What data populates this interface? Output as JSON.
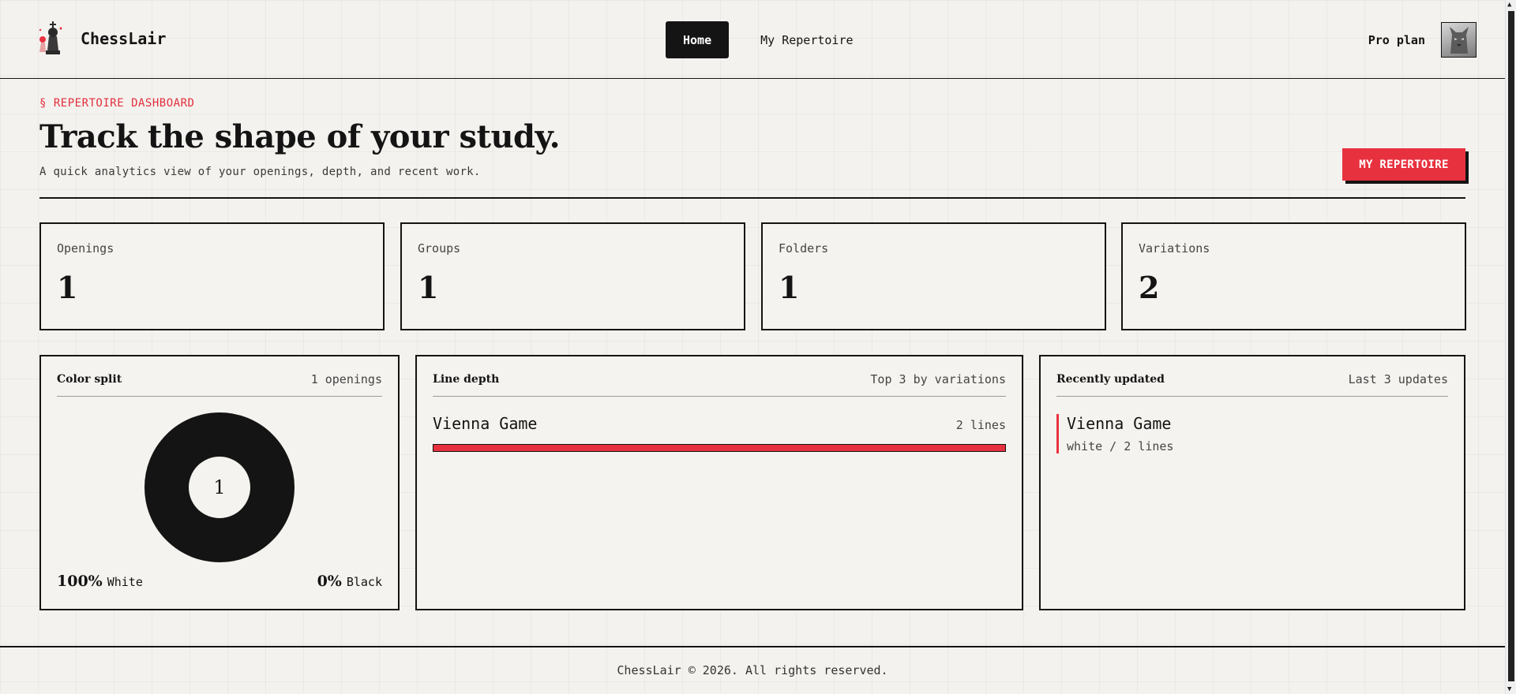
{
  "brand": {
    "name": "ChessLair",
    "logo_icon": "chess-king-icon"
  },
  "nav": {
    "items": [
      {
        "label": "Home",
        "active": true
      },
      {
        "label": "My Repertoire",
        "active": false
      }
    ]
  },
  "account": {
    "plan": "Pro plan",
    "avatar_icon": "cat-avatar-icon"
  },
  "hero": {
    "eyebrow": "§ REPERTOIRE DASHBOARD",
    "title": "Track the shape of your study.",
    "subtitle": "A quick analytics view of your openings, depth, and recent work.",
    "cta": "MY REPERTOIRE"
  },
  "stats": [
    {
      "label": "Openings",
      "value": "1"
    },
    {
      "label": "Groups",
      "value": "1"
    },
    {
      "label": "Folders",
      "value": "1"
    },
    {
      "label": "Variations",
      "value": "2"
    }
  ],
  "color_split": {
    "title": "Color split",
    "meta": "1 openings",
    "center": "1",
    "white_pct": "100%",
    "white_label": "White",
    "black_pct": "0%",
    "black_label": "Black",
    "white_fraction": 1.0
  },
  "line_depth": {
    "title": "Line depth",
    "meta": "Top 3 by variations",
    "lines": [
      {
        "name": "Vienna Game",
        "count": "2 lines",
        "fraction": 1.0
      }
    ]
  },
  "recent": {
    "title": "Recently updated",
    "meta": "Last 3 updates",
    "items": [
      {
        "name": "Vienna Game",
        "meta": "white / 2 lines"
      }
    ]
  },
  "footer": {
    "text": "ChessLair © 2026. All rights reserved."
  },
  "colors": {
    "accent": "#e8313f",
    "ink": "#141414",
    "paper": "#f4f2ee"
  }
}
